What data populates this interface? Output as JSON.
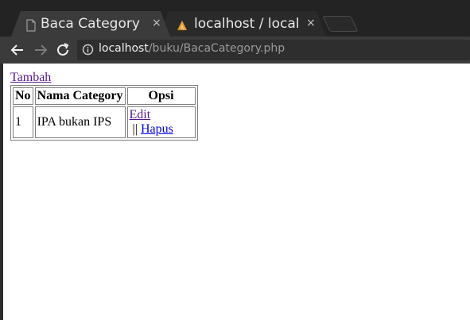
{
  "tabs": [
    {
      "title": "Baca Category",
      "close": "×",
      "icon": "page-icon"
    },
    {
      "title": "localhost / localh",
      "close": "×",
      "icon": "phpmyadmin-icon"
    }
  ],
  "toolbar": {
    "url_host": "localhost",
    "url_path": "/buku/BacaCategory.php"
  },
  "page": {
    "add_link": "Tambah",
    "table": {
      "headers": [
        "No",
        "Nama Category",
        "Opsi"
      ],
      "rows": [
        {
          "no": "1",
          "nama": "IPA bukan IPS",
          "edit": "Edit",
          "sep": " || ",
          "hapus": "Hapus"
        }
      ]
    }
  },
  "colors": {
    "link_visited": "#551a8b",
    "link_unvisited": "#0000ee",
    "chrome_dark": "#232323",
    "chrome_toolbar": "#3b3b3b"
  }
}
